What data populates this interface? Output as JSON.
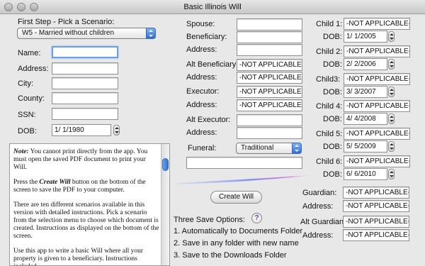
{
  "window": {
    "title": "Basic Illinois Will"
  },
  "left": {
    "step_label": "First Step - Pick a Scenario:",
    "scenario_value": "W5 - Married without children",
    "name_label": "Name:",
    "address_label": "Address:",
    "city_label": "City:",
    "county_label": "County:",
    "ssn_label": "SSN:",
    "dob_label": "DOB:",
    "dob_value": "1/  1/1980"
  },
  "notes": {
    "p1_em": "Note:",
    "p1_text": " You cannot print directly from the app. You must open the saved PDF document to print your Will.",
    "p2_a": "Press the ",
    "p2_em": "Create Will",
    "p2_b": " button on the bottom of the screen to save the PDF to your computer.",
    "p3": "There are ten different scenarios available in this version with detailed instructions. Pick a scenario from the selection menu to choose which document is created. Instructions as displayed on the bottom of the screen.",
    "p4": "Use this app to write a basic Will where all your property is given to a beneficiary. Instructions included."
  },
  "middle": {
    "spouse_label": "Spouse:",
    "beneficiary_label": "Beneficiary:",
    "address_label": "Address:",
    "alt_beneficiary_label": "Alt Beneficiary:",
    "alt_beneficiary_value": "-NOT APPLICABLE-",
    "alt_beneficiary_address_label": "Address:",
    "alt_beneficiary_address_value": "-NOT APPLICABLE-",
    "executor_label": "Executor:",
    "executor_value": "-NOT APPLICABLE-",
    "executor_address_label": "Address:",
    "executor_address_value": "-NOT APPLICABLE-",
    "alt_executor_label": "Alt Executor:",
    "alt_executor_address_label": "Address:",
    "funeral_label": "Funeral:",
    "funeral_value": "Traditional",
    "create_will_label": "Create Will",
    "save_options_title": "Three Save Options:",
    "help_glyph": "?",
    "save_option_1": "1. Automatically to Documents Folder",
    "save_option_2": "2. Save in any folder with new name",
    "save_option_3": "3. Save to the Downloads Folder"
  },
  "children": [
    {
      "label": "Child 1:",
      "value": "-NOT APPLICABLE-",
      "dob_label": "DOB:",
      "dob": "1/  1/2005"
    },
    {
      "label": "Child 2:",
      "value": "-NOT APPLICABLE-",
      "dob_label": "DOB:",
      "dob": "2/  2/2006"
    },
    {
      "label": "Child3:",
      "value": "-NOT APPLICABLE-",
      "dob_label": "DOB:",
      "dob": "3/  3/2007"
    },
    {
      "label": "Child 4:",
      "value": "-NOT APPLICABLE-",
      "dob_label": "DOB:",
      "dob": "4/  4/2008"
    },
    {
      "label": "Child 5:",
      "value": "-NOT APPLICABLE-",
      "dob_label": "DOB:",
      "dob": "5/  5/2009"
    },
    {
      "label": "Child 6:",
      "value": "-NOT APPLICABLE-",
      "dob_label": "DOB:",
      "dob": "6/  6/2010"
    }
  ],
  "guardian": {
    "guardian_label": "Guardian:",
    "guardian_value": "-NOT APPLICABLE-",
    "address_label": "Address:",
    "address_value": "-NOT APPLICABLE-",
    "alt_guardian_label": "Alt Guardian:",
    "alt_guardian_value": "-NOT APPLICABLE-",
    "alt_address_label": "Address:",
    "alt_address_value": "-NOT APPLICABLE-"
  }
}
